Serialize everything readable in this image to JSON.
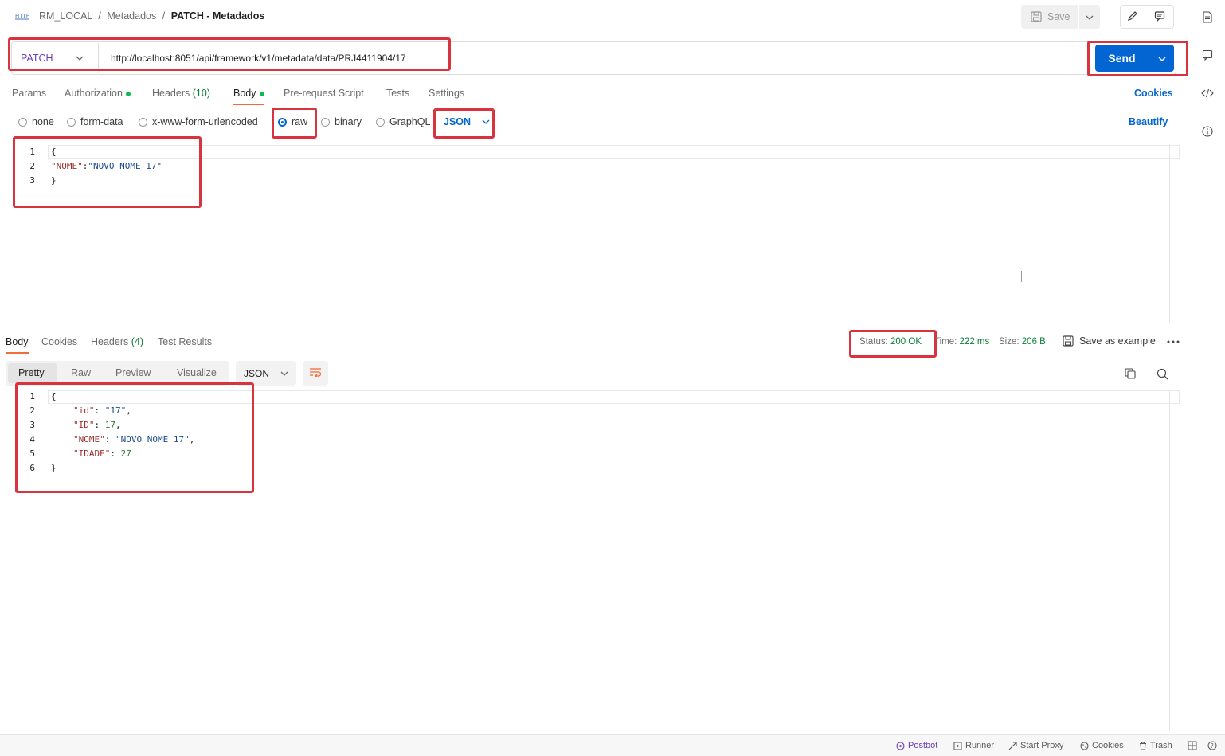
{
  "breadcrumb": {
    "collection": "RM_LOCAL",
    "folder": "Metadados",
    "request": "PATCH - Metadados",
    "sep1": "/",
    "sep2": "/"
  },
  "toolbar": {
    "save_label": "Save"
  },
  "request": {
    "method": "PATCH",
    "url": "http://localhost:8051/api/framework/v1/metadata/data/PRJ4411904/17",
    "send_label": "Send"
  },
  "request_tabs": [
    {
      "label": "Params"
    },
    {
      "label": "Authorization"
    },
    {
      "label": "Headers",
      "count": "(10)"
    },
    {
      "label": "Body"
    },
    {
      "label": "Pre-request Script"
    },
    {
      "label": "Tests"
    },
    {
      "label": "Settings"
    }
  ],
  "cookies_link": "Cookies",
  "body_types": [
    "none",
    "form-data",
    "x-www-form-urlencoded",
    "raw",
    "binary",
    "GraphQL"
  ],
  "body_language": "JSON",
  "beautify_label": "Beautify",
  "request_body": {
    "line_numbers": [
      "1",
      "2",
      "3"
    ],
    "open": "{",
    "key": "\"NOME\"",
    "colon": ":",
    "value": "\"NOVO NOME 17\"",
    "close": "}"
  },
  "response_tabs": [
    {
      "label": "Body"
    },
    {
      "label": "Cookies"
    },
    {
      "label": "Headers",
      "count": "(4)"
    },
    {
      "label": "Test Results"
    }
  ],
  "response_meta": {
    "status_label": "Status:",
    "status_value": "200 OK",
    "time_label": "Time:",
    "time_value": "222 ms",
    "size_label": "Size:",
    "size_value": "206 B",
    "save_example": "Save as example"
  },
  "response_view_modes": [
    "Pretty",
    "Raw",
    "Preview",
    "Visualize"
  ],
  "response_format": "JSON",
  "response_body": {
    "line_numbers": [
      "1",
      "2",
      "3",
      "4",
      "5",
      "6"
    ],
    "open": "{",
    "lines": [
      {
        "key": "\"id\"",
        "value": "\"17\"",
        "value_type": "string",
        "comma": ","
      },
      {
        "key": "\"ID\"",
        "value": "17",
        "value_type": "number",
        "comma": ","
      },
      {
        "key": "\"NOME\"",
        "value": "\"NOVO NOME 17\"",
        "value_type": "string",
        "comma": ","
      },
      {
        "key": "\"IDADE\"",
        "value": "27",
        "value_type": "number",
        "comma": ""
      }
    ],
    "close": "}"
  },
  "footer": {
    "postbot": "Postbot",
    "runner": "Runner",
    "start_proxy": "Start Proxy",
    "cookies": "Cookies",
    "trash": "Trash"
  },
  "colors": {
    "accent_blue": "#0265d2",
    "highlight_red": "#d9333f",
    "status_green": "#0a7d3b"
  }
}
